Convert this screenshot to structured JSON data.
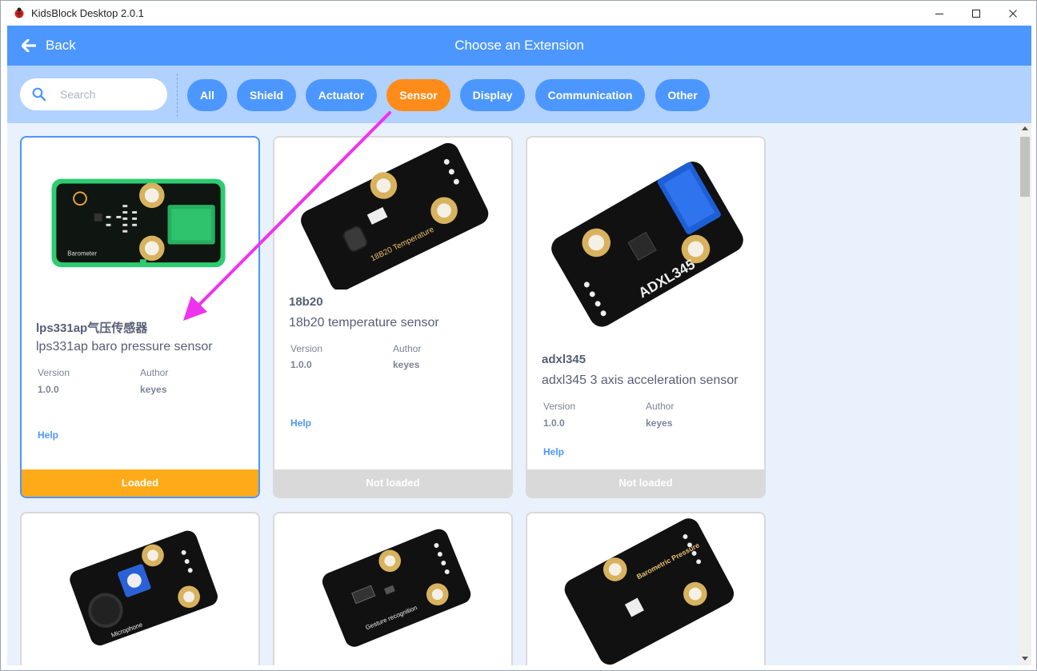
{
  "window": {
    "title": "KidsBlock Desktop 2.0.1"
  },
  "header": {
    "back_label": "Back",
    "title": "Choose an Extension"
  },
  "search": {
    "placeholder": "Search"
  },
  "tags": [
    {
      "label": "All",
      "active": false
    },
    {
      "label": "Shield",
      "active": false
    },
    {
      "label": "Actuator",
      "active": false
    },
    {
      "label": "Sensor",
      "active": true
    },
    {
      "label": "Display",
      "active": false
    },
    {
      "label": "Communication",
      "active": false
    },
    {
      "label": "Other",
      "active": false
    }
  ],
  "colors": {
    "header": "#4c97ff",
    "filterbar": "#b1d1ff",
    "active_tag": "#ff8c1a",
    "loaded": "#ffab19",
    "not_loaded": "#d9d9d9",
    "annotation_arrow": "#ee33ee"
  },
  "cards": [
    {
      "name": "lps331ap气压传感器",
      "description": "lps331ap baro pressure sensor",
      "version_label": "Version",
      "version": "1.0.0",
      "author_label": "Author",
      "author": "keyes",
      "help_label": "Help",
      "status": "Loaded",
      "image_text": "Barometer"
    },
    {
      "name": "18b20",
      "description": "18b20 temperature sensor",
      "version_label": "Version",
      "version": "1.0.0",
      "author_label": "Author",
      "author": "keyes",
      "help_label": "Help",
      "status": "Not loaded",
      "image_text": "18B20 Temperature"
    },
    {
      "name": "adxl345",
      "description": "adxl345 3 axis acceleration sensor",
      "version_label": "Version",
      "version": "1.0.0",
      "author_label": "Author",
      "author": "keyes",
      "help_label": "Help",
      "status": "Not loaded",
      "image_text": "ADXL345"
    }
  ],
  "partial_cards": [
    {
      "image_text": "Microphone"
    },
    {
      "image_text": "Gesture recognition"
    },
    {
      "image_text": "Barometric Pressure"
    }
  ]
}
